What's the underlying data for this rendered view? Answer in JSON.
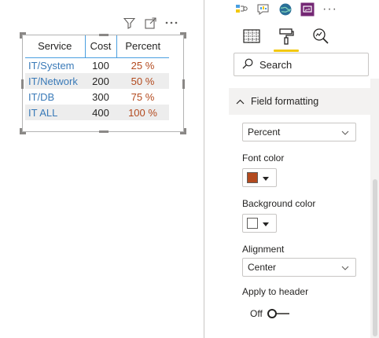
{
  "table": {
    "columns": [
      "Service",
      "Cost",
      "Percent"
    ],
    "rows": [
      {
        "service": "IT/System",
        "cost": "100",
        "percent": "25 %"
      },
      {
        "service": "IT/Network",
        "cost": "200",
        "percent": "50 %"
      },
      {
        "service": "IT/DB",
        "cost": "300",
        "percent": "75 %"
      },
      {
        "service": "IT ALL",
        "cost": "400",
        "percent": "100 %"
      }
    ]
  },
  "visual_header": {
    "icons": [
      "filter-icon",
      "focus-mode-icon",
      "more-options-icon"
    ]
  },
  "pane": {
    "viz_icons": [
      "key-influencers-icon",
      "qna-icon",
      "arcgis-map-icon",
      "custom-visual-icon",
      "more-icon"
    ],
    "more_label": "···",
    "tabs": [
      "fields-tab",
      "format-tab",
      "analytics-tab"
    ],
    "search_placeholder": "Search",
    "section_title": "Field formatting",
    "field_select": "Percent",
    "font_color_label": "Font color",
    "font_color_value": "#b34a1e",
    "background_color_label": "Background color",
    "background_color_value": "#ffffff",
    "alignment_label": "Alignment",
    "alignment_value": "Center",
    "apply_header_label": "Apply to header",
    "apply_header_state": "Off"
  },
  "colors": {
    "accent_underline": "#f2c811",
    "service_text": "#3a7ab8",
    "percent_text": "#b34a1e",
    "header_border": "#4a9fe0"
  }
}
